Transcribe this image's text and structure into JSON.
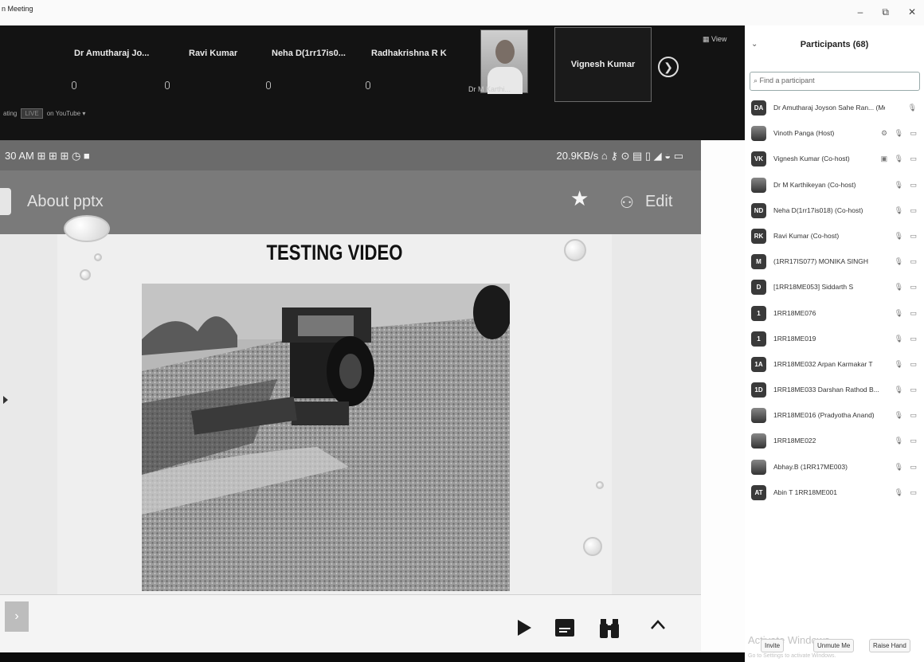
{
  "window": {
    "title": "n Meeting",
    "controls": [
      "–",
      "⧉",
      "✕"
    ]
  },
  "strip": {
    "participants": [
      "Dr Amutharaj Jo...",
      "Ravi Kumar",
      "Neha D(1rr17is0...",
      "Radhakrishna R K"
    ],
    "photo_name": "Dr M Karthi...",
    "active_name": "Vignesh Kumar",
    "view_label": "View",
    "recording_label": "ating",
    "live_label": "LIVE",
    "live_on": "on YouTube ▾"
  },
  "share": {
    "status_left": "30 AM ⊞ ⊞ ⊞ ◷ ■",
    "status_right": "20.9KB/s ⌂ ⚷ ⊙ ▤ ▯ ◢ ◒ ▭",
    "doc_title": "About pptx",
    "edit_label": "Edit",
    "slide_title": "TESTING VIDEO"
  },
  "panel": {
    "header": "Participants (68)",
    "search_placeholder": "Find a participant",
    "participants": [
      {
        "initials": "DA",
        "name": "Dr Amutharaj Joyson Sahe Ran... (Me)",
        "icons": "🎙"
      },
      {
        "initials": "",
        "name": "Vinoth Panga (Host)",
        "icons": "⚙ 🎙 ▭"
      },
      {
        "initials": "VK",
        "name": "Vignesh Kumar (Co-host)",
        "icons": "▣ 🎙 ▭"
      },
      {
        "initials": "",
        "name": "Dr M Karthikeyan (Co-host)",
        "icons": "🎙 ▭"
      },
      {
        "initials": "ND",
        "name": "Neha D(1rr17is018) (Co-host)",
        "icons": "🎙 ▭"
      },
      {
        "initials": "RK",
        "name": "Ravi Kumar (Co-host)",
        "icons": "🎙 ▭"
      },
      {
        "initials": "M",
        "name": "(1RR17IS077) MONIKA SINGH",
        "icons": "🎙 ▭"
      },
      {
        "initials": "D",
        "name": "[1RR18ME053] Siddarth S",
        "icons": "🎙 ▭"
      },
      {
        "initials": "1",
        "name": "1RR18ME076",
        "icons": "🎙 ▭"
      },
      {
        "initials": "1",
        "name": "1RR18ME019",
        "icons": "🎙 ▭"
      },
      {
        "initials": "1A",
        "name": "1RR18ME032 Arpan Karmakar T",
        "icons": "🎙 ▭"
      },
      {
        "initials": "1D",
        "name": "1RR18ME033 Darshan Rathod B...",
        "icons": "🎙 ▭"
      },
      {
        "initials": "",
        "name": "1RR18ME016 (Pradyotha Anand)",
        "icons": "🎙 ▭"
      },
      {
        "initials": "",
        "name": "1RR18ME022",
        "icons": "🎙 ▭"
      },
      {
        "initials": "",
        "name": "Abhay.B (1RR17ME003)",
        "icons": "🎙 ▭"
      },
      {
        "initials": "AT",
        "name": "Abin T 1RR18ME001",
        "icons": "🎙 ▭"
      }
    ],
    "invite_label": "Invite",
    "unmute_label": "Unmute Me",
    "raise_label": "Raise Hand",
    "watermark": "Activate Windows",
    "watermark_sub": "Go to Settings to activate Windows."
  }
}
